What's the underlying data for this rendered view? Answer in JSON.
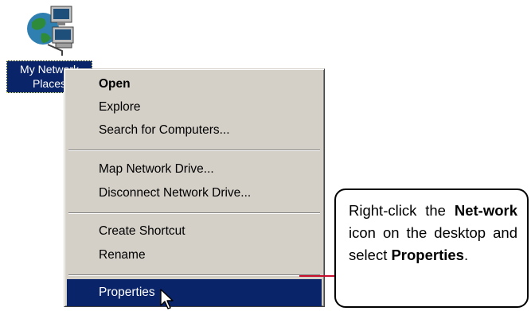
{
  "desktop_icon": {
    "icon": "network-places-icon",
    "label_line1": "My Network",
    "label_line2": "Places"
  },
  "context_menu": {
    "items": [
      {
        "label": "Open",
        "default": true
      },
      {
        "label": "Explore"
      },
      {
        "label": "Search for Computers..."
      },
      {
        "label": "Map Network Drive..."
      },
      {
        "label": "Disconnect Network Drive..."
      },
      {
        "label": "Create Shortcut"
      },
      {
        "label": "Rename"
      },
      {
        "label": "Properties",
        "selected": true
      }
    ]
  },
  "callout": {
    "t1": "Right-click the ",
    "b1": "Net-work",
    "t2": " icon on the desktop and select ",
    "b2": "Properties",
    "t3": "."
  },
  "colors": {
    "selection": "#0a246a",
    "menu_face": "#d4d0c8",
    "leader_line": "#c8102e"
  }
}
